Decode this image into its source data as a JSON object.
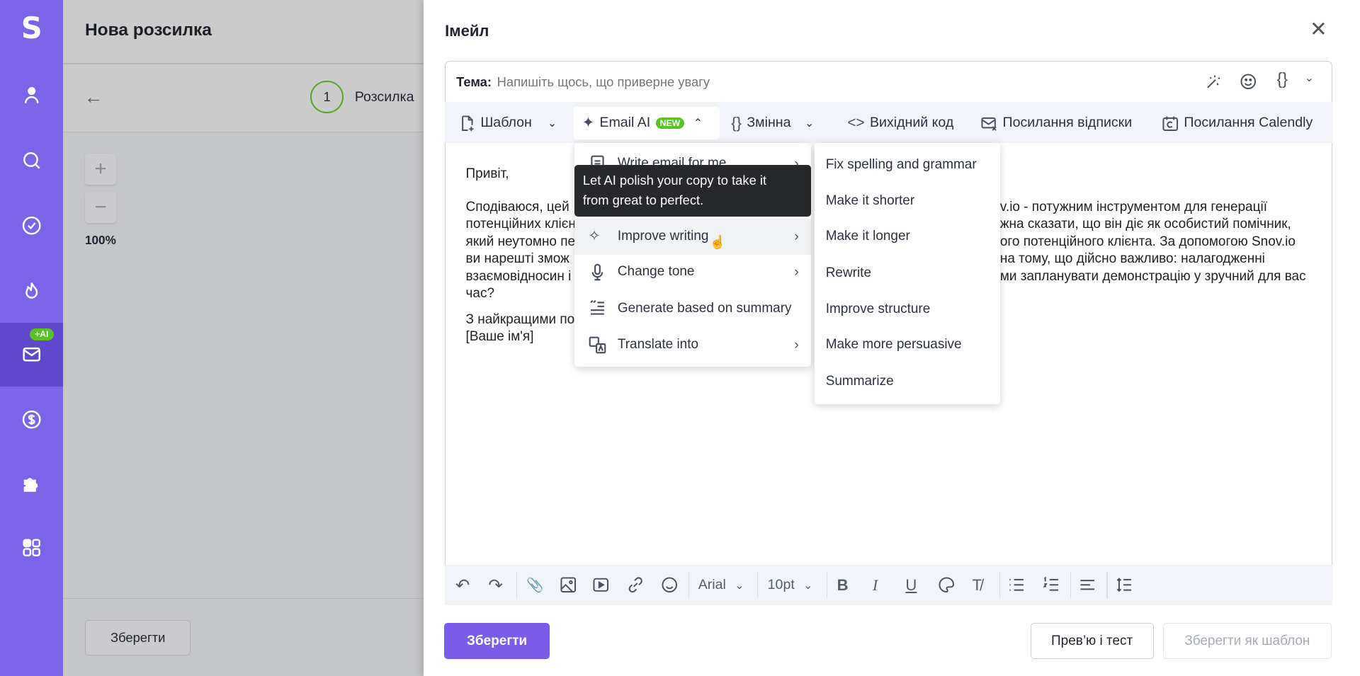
{
  "sidebar": {
    "logo": "S",
    "items": [
      "contacts-icon",
      "search-icon",
      "tasks-icon",
      "fire-icon",
      "mail-icon",
      "dollar-icon",
      "puzzle-icon",
      "apps-icon"
    ],
    "active": "mail-icon",
    "ai_badge": "+AI",
    "accent": "#7b64e8"
  },
  "page": {
    "title": "Нова розсилка",
    "step_number": "1",
    "step_label": "Розсилка",
    "zoom_level": "100%",
    "save_label": "Зберегти"
  },
  "panel": {
    "title": "Імейл",
    "subject": {
      "label": "Тема:",
      "placeholder": "Напишіть щось, що приверне увагу"
    },
    "toolbar": {
      "template": "Шаблон",
      "email_ai": "Email AI",
      "new_badge": "NEW",
      "variable": "Змінна",
      "source": "Вихідний код",
      "unsubscribe": "Посилання відписки",
      "calendly": "Посилання Calendly"
    },
    "body": {
      "greeting": "Привіт,",
      "left": [
        "Сподіваюся, цей",
        "потенційних клієн",
        "який неутомно пе",
        "ви нарешті змож",
        "взаємовідносин і",
        "час?"
      ],
      "right": [
        "v.io - потужним інструментом для генерації",
        "жна сказати, що він діє як особистий помічник,",
        "ого потенційного клієнта. За допомогою Snov.io",
        " на тому, що дійсно важливо: налагодженні",
        "ми запланувати демонстрацію у зручний для вас"
      ],
      "signoff": "З найкращими по",
      "signature": "[Ваше ім'я]"
    },
    "ai_menu": {
      "items": [
        "Write email for me",
        "Improve writing",
        "Change tone",
        "Generate based on summary",
        "Translate into"
      ],
      "hovered": "Improve writing",
      "tooltip": [
        "Let AI polish your copy to take it",
        "from great to perfect."
      ]
    },
    "submenu": [
      "Fix spelling and grammar",
      "Make it shorter",
      "Make it longer",
      "Rewrite",
      "Improve structure",
      "Make more persuasive",
      "Summarize"
    ],
    "format": {
      "font": "Arial",
      "size": "10pt"
    },
    "buttons": {
      "save": "Зберегти",
      "preview": "Прев’ю і тест",
      "save_template": "Зберегти як шаблон"
    },
    "save_color": "#7b5ce8"
  }
}
